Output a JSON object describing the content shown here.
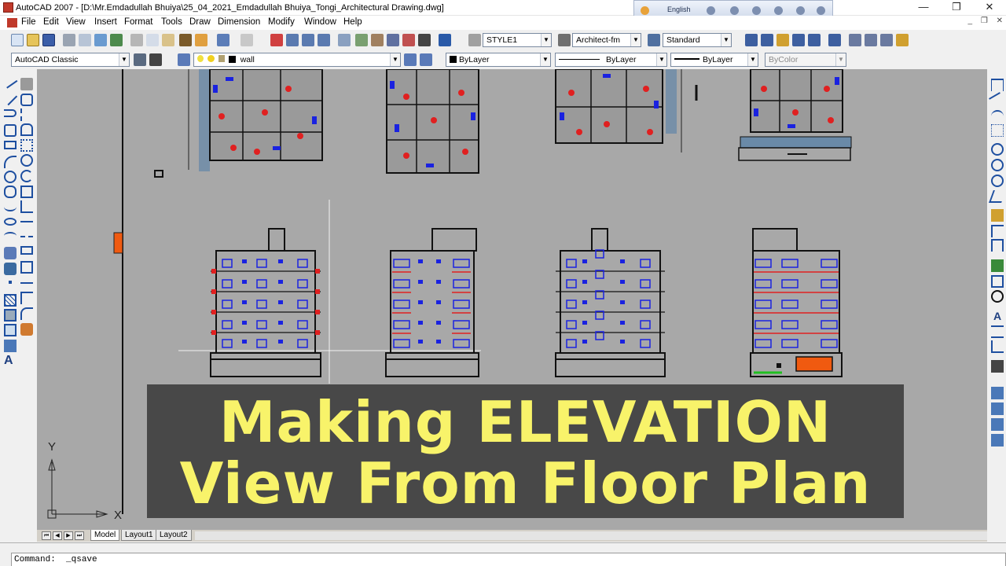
{
  "window": {
    "title": "AutoCAD 2007 - [D:\\Mr.Emdadullah Bhuiya\\25_04_2021_Emdadullah Bhuiya_Tongi_Architectural Drawing.dwg]",
    "language": "English",
    "minimize": "—",
    "restore": "❐",
    "close": "✕",
    "mdi_minimize": "_",
    "mdi_restore": "❐",
    "mdi_close": "✕"
  },
  "menu": [
    {
      "label": "File"
    },
    {
      "label": "Edit"
    },
    {
      "label": "View"
    },
    {
      "label": "Insert"
    },
    {
      "label": "Format"
    },
    {
      "label": "Tools"
    },
    {
      "label": "Draw"
    },
    {
      "label": "Dimension"
    },
    {
      "label": "Modify"
    },
    {
      "label": "Window"
    },
    {
      "label": "Help"
    }
  ],
  "toolbars": {
    "text_style": "STYLE1",
    "dim_style": "Architect-fm",
    "table_style": "Standard",
    "workspace": "AutoCAD Classic",
    "layer": "wall",
    "color": "ByLayer",
    "linetype": "ByLayer",
    "lineweight": "ByLayer",
    "plot_style": "ByColor"
  },
  "drawing": {
    "ucs_y": "Y",
    "ucs_x": "X"
  },
  "banner": {
    "line1": "Making ELEVATION",
    "line2": "View From Floor Plan"
  },
  "tabs": [
    {
      "label": "Model",
      "active": true
    },
    {
      "label": "Layout1",
      "active": false
    },
    {
      "label": "Layout2",
      "active": false
    }
  ],
  "tab_nav": [
    "⏮",
    "◀",
    "▶",
    "⏭"
  ],
  "command": {
    "prompt": "Command:",
    "value": "_qsave"
  },
  "colors": {
    "canvas": "#a8a8a8",
    "banner_bg": "#484848",
    "banner_text": "#f8f36a",
    "window_blue": "#1a22e0",
    "door_red": "#e02020",
    "accent_orange": "#f05a10"
  }
}
